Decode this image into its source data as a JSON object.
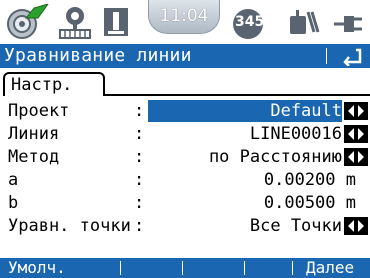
{
  "status": {
    "clock": "11:04",
    "battery_label": "345"
  },
  "titlebar": {
    "title": "Уравнивание линии"
  },
  "tabs": [
    {
      "label": "Настр."
    }
  ],
  "form": {
    "rows": [
      {
        "label": "Проект",
        "value": "Default",
        "has_list": true
      },
      {
        "label": "Линия",
        "value": "LINE00016",
        "has_list": true
      },
      {
        "label": "Метод",
        "value": "по Расстоянию",
        "has_list": true
      },
      {
        "label": "a",
        "value": "0.00200 m",
        "has_list": false
      },
      {
        "label": "b",
        "value": "0.00500 m",
        "has_list": false
      },
      {
        "label": "Уравн. точки",
        "value": "Все Точки",
        "has_list": true
      }
    ],
    "colon": ":"
  },
  "softkeys": {
    "f1": "Умолч.",
    "f6": "Далее"
  },
  "colors": {
    "accent": "#1a66b0",
    "background": "#ffffff"
  }
}
